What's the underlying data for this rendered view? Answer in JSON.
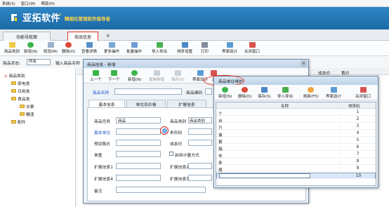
{
  "menubar": {
    "items": [
      "系统(S)",
      "窗口(W)",
      "帮助(H)"
    ]
  },
  "banner": {
    "brand": "亚拓软件",
    "dot": "·",
    "tagline": "精细化管理软件倡导者"
  },
  "tabs": [
    {
      "label": "功能导航面"
    },
    {
      "label": "商品信息"
    }
  ],
  "tab_close": "×",
  "toolbar": {
    "buttons": [
      "商品类别",
      "新增(N)",
      "修改(M)",
      "删除(D)",
      "查看详情",
      "更多操作",
      "批量操作",
      "导入导出",
      "排序设置",
      "打印",
      "界面设计",
      "关闭窗口"
    ]
  },
  "filter": {
    "label_status": "商品状态:",
    "status_value": "所有",
    "search_label": "输入商品名称"
  },
  "tree": {
    "root": "商品类别",
    "children": [
      "家电类",
      "日用类",
      "食品类",
      "水果",
      "糖渣",
      "配件"
    ]
  },
  "grid": {
    "col_right1": "成本价",
    "col_right2": "售价"
  },
  "dialog1": {
    "title": "商品信息 - 新增",
    "buttons": [
      "上一个",
      "下一个",
      "新增(N)",
      "复制新增",
      "保存(S)",
      "界面设计",
      "关"
    ],
    "name_label": "商品名称",
    "code_label": "商品编码",
    "tabs": [
      "基本信息",
      "单位及价格",
      "扩展信息"
    ],
    "left_fields": [
      "商品任务",
      "基本单位",
      "预设售价",
      "单重",
      "扩展信息1",
      "扩展信息4",
      "备注"
    ],
    "right_fields": [
      "商品类别",
      "条形码",
      "成本价",
      "启用计量方式",
      "扩展信息2",
      "扩展信息5"
    ],
    "task_value": "商品",
    "category_value": "商品类别"
  },
  "dialog2": {
    "title": "商品单位维护",
    "buttons": [
      "新增(N)",
      "删除(D)",
      "保存(S)",
      "导入导出",
      "刷新(F5)",
      "界面设计",
      "关闭窗口"
    ],
    "columns": [
      "名称",
      "排序码"
    ],
    "rows": [
      {
        "name": "个",
        "sort": "1"
      },
      {
        "name": "台",
        "sort": "2"
      },
      {
        "name": "只",
        "sort": "3"
      },
      {
        "name": "盒",
        "sort": "4"
      },
      {
        "name": "套",
        "sort": "5"
      },
      {
        "name": "箱",
        "sort": "6"
      },
      {
        "name": "米",
        "sort": "7"
      },
      {
        "name": "条",
        "sort": "8"
      },
      {
        "name": "瓶",
        "sort": "9"
      },
      {
        "name": "",
        "sort": "10"
      }
    ]
  },
  "colors": {
    "brand_blue": "#1c6aa6",
    "accent_red": "#e0241b",
    "tagline_yellow": "#ffd54a"
  }
}
